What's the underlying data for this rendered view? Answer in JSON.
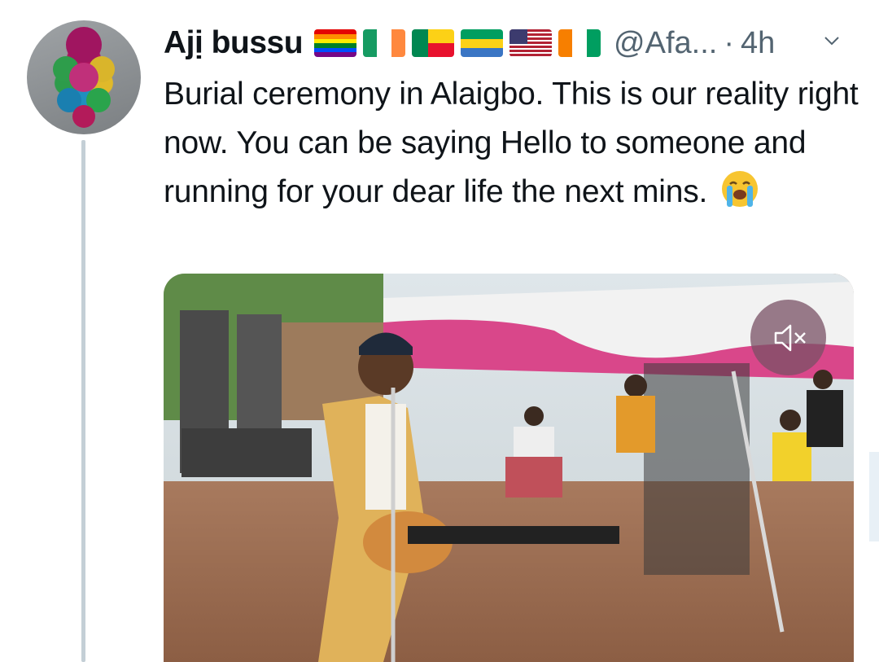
{
  "tweet": {
    "author_name": "Ajị bussu",
    "handle": "@Afa...",
    "separator": "·",
    "time": "4h",
    "text": "Burial ceremony in Alaigbo. This is our reality right now. You can be saying Hello to someone and running for your dear life the next mins.",
    "emoji": "loudly-crying-face",
    "flags": [
      "rainbow-flag",
      "ireland-flag",
      "benin-flag",
      "gabon-flag",
      "usa-flag",
      "ivory-coast-flag"
    ]
  },
  "media": {
    "type": "video",
    "muted": true,
    "mute_icon": "speaker-muted-icon"
  },
  "colors": {
    "text": "#0f1419",
    "secondary": "#536471",
    "thread_line": "#c4cfd6"
  }
}
